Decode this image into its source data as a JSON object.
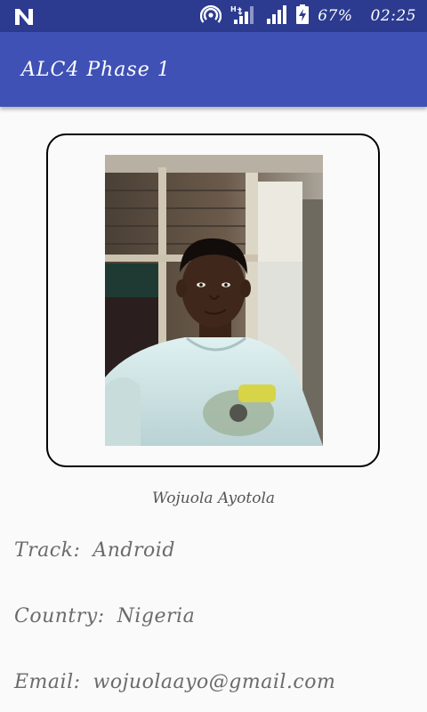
{
  "status_bar": {
    "battery_percent": "67%",
    "time": "02:25",
    "icons": [
      "n-notification-icon",
      "hotspot-icon",
      "h-plus-signal-icon",
      "cell-signal-icon",
      "battery-charging-icon"
    ]
  },
  "app_bar": {
    "title": "ALC4 Phase 1",
    "color": "#3f51b5"
  },
  "profile": {
    "photo_icon": "profile-photo",
    "name": "Wojuola Ayotola"
  },
  "details": {
    "track_label": "Track:",
    "track_value": "Android",
    "country_label": "Country:",
    "country_value": "Nigeria",
    "email_label": "Email:",
    "email_value": "wojuolaayo@gmail.com"
  }
}
